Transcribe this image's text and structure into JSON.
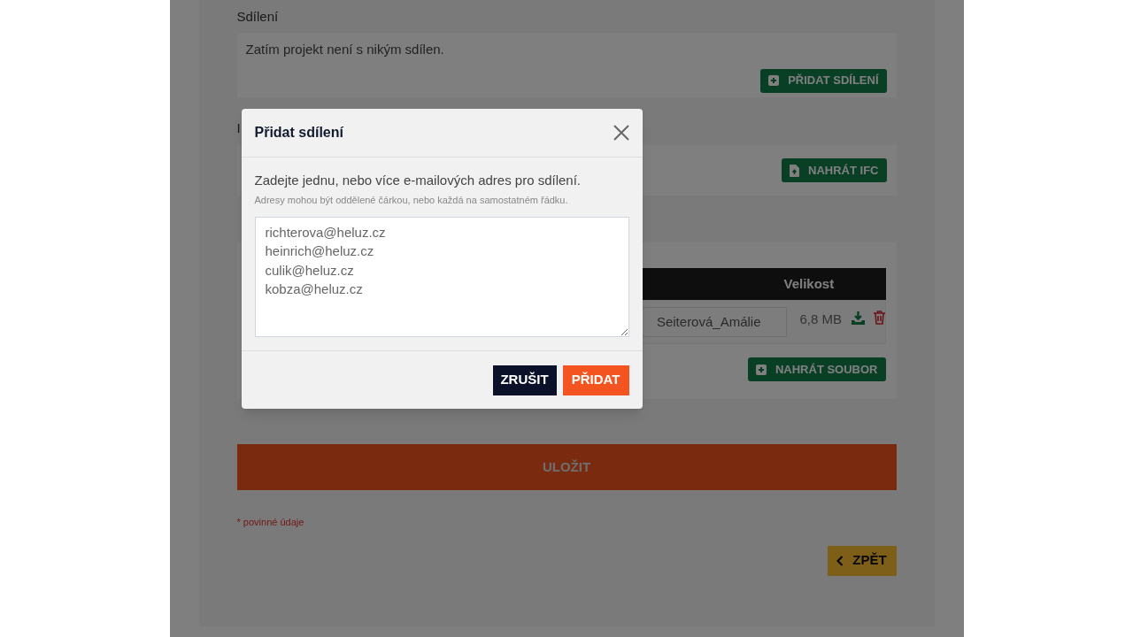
{
  "sharing": {
    "label": "Sdílení",
    "empty_text": "Zatím projekt není s nikým sdílen.",
    "add_button": "PŘIDAT SDÍLENÍ"
  },
  "ifc": {
    "label": "I",
    "upload_button": "NAHRÁT IFC"
  },
  "documents": {
    "columns": [
      {
        "label": "Velikost"
      }
    ],
    "rows": [
      {
        "file_name": "Seiterová_Amálie",
        "size": "6,8 MB"
      }
    ],
    "upload_button": "NAHRÁT SOUBOR"
  },
  "save_button": "ULOŽIT",
  "required_note": "* povinné údaje",
  "back_button": "ZPĚT",
  "dialog": {
    "title": "Přidat sdílení",
    "instruction": "Zadejte jednu, nebo více e-mailových adres pro sdílení.",
    "hint": "Adresy mohou být oddělené čárkou, nebo každá na samostatném řádku.",
    "emails": "richterova@heluz.cz\nheinrich@heluz.cz\nculik@heluz.cz\nkobza@heluz.cz",
    "cancel_button": "ZRUŠIT",
    "confirm_button": "PŘIDAT"
  }
}
